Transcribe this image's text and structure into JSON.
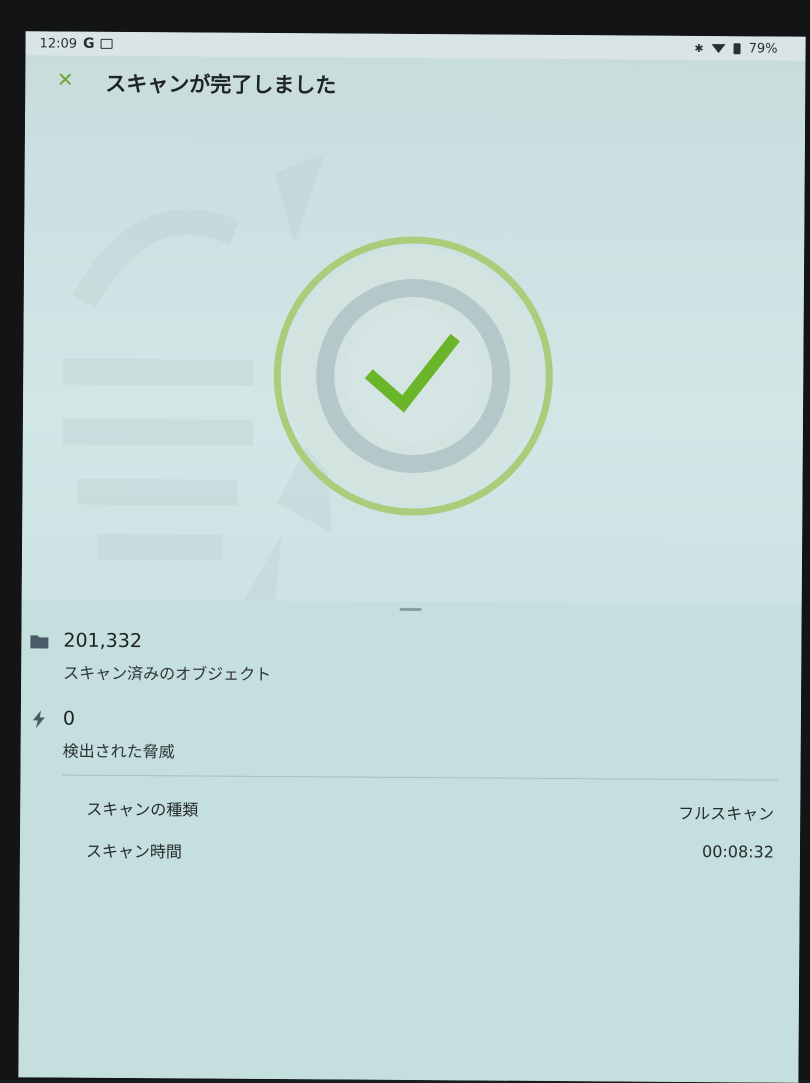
{
  "statusbar": {
    "time": "12:09",
    "g_label": "G",
    "battery": "79%"
  },
  "header": {
    "title": "スキャンが完了しました"
  },
  "results": {
    "objects": {
      "value": "201,332",
      "label": "スキャン済みのオブジェクト",
      "icon": "folder-icon"
    },
    "threats": {
      "value": "0",
      "label": "検出された脅威",
      "icon": "lightning-icon"
    }
  },
  "details": {
    "scan_type_label": "スキャンの種類",
    "scan_type_value": "フルスキャン",
    "scan_time_label": "スキャン時間",
    "scan_time_value": "00:08:32"
  },
  "colors": {
    "accent_green": "#6bb52a",
    "ring_green": "#a8cc7a"
  }
}
